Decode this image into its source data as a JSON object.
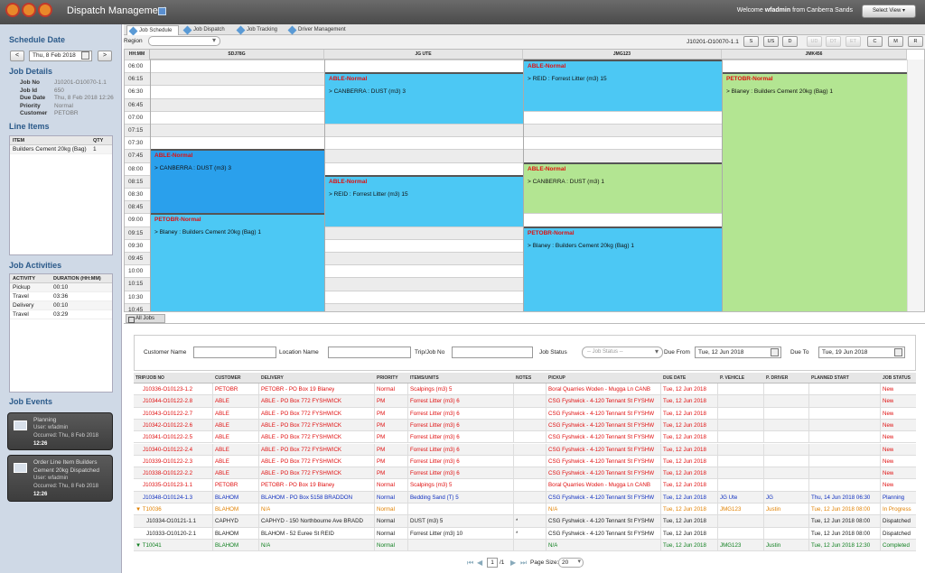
{
  "header": {
    "app_title": "Dispatch Management",
    "welcome_prefix": "Welcome",
    "user": "wfadmin",
    "welcome_suffix": "from Canberra Sands",
    "select_view": "Select View ▾"
  },
  "sidebar": {
    "schedule_date_title": "Schedule Date",
    "prev": "<",
    "next": ">",
    "date": "Thu, 8 Feb 2018",
    "job_details_title": "Job Details",
    "job_details": [
      {
        "label": "Job No",
        "value": "J10201-O10070-1.1"
      },
      {
        "label": "Job Id",
        "value": "650"
      },
      {
        "label": "Due Date",
        "value": "Thu, 8 Feb 2018 12:26"
      },
      {
        "label": "Priority",
        "value": "Normal"
      },
      {
        "label": "Customer",
        "value": "PETOBR"
      }
    ],
    "line_items_title": "Line Items",
    "line_items_headers": {
      "item": "ITEM",
      "qty": "QTY"
    },
    "line_items": [
      {
        "item": "Builders Cement 20kg (Bag)",
        "qty": "1"
      }
    ],
    "activities_title": "Job Activities",
    "activities_headers": {
      "activity": "ACTIVITY",
      "duration": "DURATION (HH:MM)"
    },
    "activities": [
      {
        "activity": "Pickup",
        "duration": "00:10"
      },
      {
        "activity": "Travel",
        "duration": "03:36"
      },
      {
        "activity": "Delivery",
        "duration": "00:10"
      },
      {
        "activity": "Travel",
        "duration": "03:29"
      }
    ],
    "events_title": "Job Events",
    "events": [
      {
        "title": "Planning",
        "user": "User: wfadmin",
        "occurred": "Occurred: Thu, 8 Feb 2018",
        "time": "12:26"
      },
      {
        "title": "Order Line Item Builders",
        "title2": "Cement 20kg Dispatched",
        "user": "User: wfadmin",
        "occurred": "Occurred: Thu, 8 Feb 2018",
        "time": "12:26"
      }
    ]
  },
  "tabs": [
    "Job Schedule",
    "Job Dispatch",
    "Job Tracking",
    "Driver Management"
  ],
  "schedule": {
    "region_label": "Region",
    "job_ref": "J10201-O10070-1.1",
    "view_buttons": [
      "S",
      "US",
      "D",
      "UD",
      "DT",
      "ET",
      "C",
      "M",
      "R"
    ],
    "disabled_buttons": [
      "UD",
      "DT",
      "ET"
    ],
    "time_header": "HH:MM",
    "columns": [
      "SDJ78G",
      "JG UTE",
      "JMG123",
      "JMK456"
    ],
    "times": [
      "06:00",
      "06:15",
      "06:30",
      "06:45",
      "07:00",
      "07:15",
      "07:30",
      "07:45",
      "08:00",
      "08:15",
      "08:30",
      "08:45",
      "09:00",
      "09:15",
      "09:30",
      "09:45",
      "10:00",
      "10:15",
      "10:30",
      "10:45"
    ],
    "blocks": [
      {
        "title": "ABLE-Normal",
        "detail": "> CANBERRA : DUST (m3) 3",
        "color": "dblue"
      },
      {
        "title": "PETOBR-Normal",
        "detail": "> Blaney : Builders Cement 20kg (Bag) 1",
        "color": "blue"
      },
      {
        "title": "ABLE-Normal",
        "detail": "> CANBERRA : DUST (m3) 3",
        "color": "blue"
      },
      {
        "title": "ABLE-Normal",
        "detail": "> REID : Forrest Litter (m3) 15",
        "color": "blue"
      },
      {
        "title": "ABLE-Normal",
        "detail": "> REID : Forrest Litter (m3) 15",
        "color": "blue"
      },
      {
        "title": "ABLE-Normal",
        "detail": "> CANBERRA : DUST (m3) 1",
        "color": "green"
      },
      {
        "title": "PETOBR-Normal",
        "detail": "> Blaney : Builders Cement 20kg (Bag) 1",
        "color": "blue"
      },
      {
        "title": "PETOBR-Normal",
        "detail": "> Blaney : Builders Cement 20kg (Bag) 1",
        "color": "green"
      }
    ]
  },
  "all_jobs": {
    "tab": "All Jobs",
    "filters": {
      "customer_name": "Customer Name",
      "location_name": "Location Name",
      "trip_job_no": "Trip/Job No",
      "job_status": "Job Status",
      "job_status_placeholder": "-- Job Status --",
      "due_from": "Due From",
      "due_from_value": "Tue, 12 Jun 2018",
      "due_to": "Due To",
      "due_to_value": "Tue, 19 Jun 2018"
    },
    "headers": [
      "TRIP/JOB NO",
      "CUSTOMER",
      "DELIVERY",
      "PRIORITY",
      "ITEMS/UNITS",
      "NOTES",
      "PICKUP",
      "DUE DATE",
      "P. VEHICLE",
      "P. DRIVER",
      "PLANNED START",
      "JOB STATUS"
    ],
    "rows": [
      {
        "c": [
          "J10336-O10123-1.2",
          "PETOBR",
          "PETOBR - PO Box 19 Blaney",
          "Normal",
          "Scalpings (m3) 5",
          "",
          "Boral Quarries Woden - Mugga Ln CANB",
          "Tue, 12 Jun 2018",
          "",
          "",
          "",
          "New"
        ],
        "color": "red"
      },
      {
        "c": [
          "J10344-O10122-2.8",
          "ABLE",
          "ABLE - PO Box 772 FYSHWICK",
          "PM",
          "Forrest Litter (m3) 6",
          "",
          "CSG Fyshwick - 4-120 Tennant St FYSHW",
          "Tue, 12 Jun 2018",
          "",
          "",
          "",
          "New"
        ],
        "color": "red"
      },
      {
        "c": [
          "J10343-O10122-2.7",
          "ABLE",
          "ABLE - PO Box 772 FYSHWICK",
          "PM",
          "Forrest Litter (m3) 6",
          "",
          "CSG Fyshwick - 4-120 Tennant St FYSHW",
          "Tue, 12 Jun 2018",
          "",
          "",
          "",
          "New"
        ],
        "color": "red"
      },
      {
        "c": [
          "J10342-O10122-2.6",
          "ABLE",
          "ABLE - PO Box 772 FYSHWICK",
          "PM",
          "Forrest Litter (m3) 6",
          "",
          "CSG Fyshwick - 4-120 Tennant St FYSHW",
          "Tue, 12 Jun 2018",
          "",
          "",
          "",
          "New"
        ],
        "color": "red"
      },
      {
        "c": [
          "J10341-O10122-2.5",
          "ABLE",
          "ABLE - PO Box 772 FYSHWICK",
          "PM",
          "Forrest Litter (m3) 6",
          "",
          "CSG Fyshwick - 4-120 Tennant St FYSHW",
          "Tue, 12 Jun 2018",
          "",
          "",
          "",
          "New"
        ],
        "color": "red"
      },
      {
        "c": [
          "J10340-O10122-2.4",
          "ABLE",
          "ABLE - PO Box 772 FYSHWICK",
          "PM",
          "Forrest Litter (m3) 6",
          "",
          "CSG Fyshwick - 4-120 Tennant St FYSHW",
          "Tue, 12 Jun 2018",
          "",
          "",
          "",
          "New"
        ],
        "color": "red"
      },
      {
        "c": [
          "J10339-O10122-2.3",
          "ABLE",
          "ABLE - PO Box 772 FYSHWICK",
          "PM",
          "Forrest Litter (m3) 6",
          "",
          "CSG Fyshwick - 4-120 Tennant St FYSHW",
          "Tue, 12 Jun 2018",
          "",
          "",
          "",
          "New"
        ],
        "color": "red"
      },
      {
        "c": [
          "J10338-O10122-2.2",
          "ABLE",
          "ABLE - PO Box 772 FYSHWICK",
          "PM",
          "Forrest Litter (m3) 6",
          "",
          "CSG Fyshwick - 4-120 Tennant St FYSHW",
          "Tue, 12 Jun 2018",
          "",
          "",
          "",
          "New"
        ],
        "color": "red"
      },
      {
        "c": [
          "J10335-O10123-1.1",
          "PETOBR",
          "PETOBR - PO Box 19 Blaney",
          "Normal",
          "Scalpings (m3) 5",
          "",
          "Boral Quarries Woden - Mugga Ln CANB",
          "Tue, 12 Jun 2018",
          "",
          "",
          "",
          "New"
        ],
        "color": "red"
      },
      {
        "c": [
          "J10348-O10124-1.3",
          "BLAHOM",
          "BLAHOM - PO Box 5158 BRADDON",
          "Normal",
          "Bedding Sand (T) 5",
          "",
          "CSG Fyshwick - 4-120 Tennant St FYSHW",
          "Tue, 12 Jun 2018",
          "JG Ute",
          "JG",
          "Thu, 14 Jun 2018 06:30",
          "Planning"
        ],
        "color": "blu"
      },
      {
        "c": [
          "▼ T10036",
          "BLAHOM",
          "N/A",
          "Normal",
          "",
          "",
          "N/A",
          "Tue, 12 Jun 2018",
          "JMG123",
          "Justin",
          "Tue, 12 Jun 2018 08:00",
          "In Progress"
        ],
        "color": "orn"
      },
      {
        "c": [
          "J10334-O10121-1.1",
          "CAPHYD",
          "CAPHYD - 150 Northbourne Ave BRADD",
          "Normal",
          "DUST (m3) 5",
          "*",
          "CSG Fyshwick - 4-120 Tennant St FYSHW",
          "Tue, 12 Jun 2018",
          "",
          "",
          "Tue, 12 Jun 2018 08:00",
          "Dispatched"
        ],
        "color": "blk",
        "indent": true
      },
      {
        "c": [
          "J10333-O10120-2.1",
          "BLAHOM",
          "BLAHOM - 52 Euree St REID",
          "Normal",
          "Forrest Litter (m3) 10",
          "*",
          "CSG Fyshwick - 4-120 Tennant St FYSHW",
          "Tue, 12 Jun 2018",
          "",
          "",
          "Tue, 12 Jun 2018 08:00",
          "Dispatched"
        ],
        "color": "blk",
        "indent": true
      },
      {
        "c": [
          "▼ T10041",
          "BLAHOM",
          "N/A",
          "Normal",
          "",
          "",
          "N/A",
          "Tue, 12 Jun 2018",
          "JMG123",
          "Justin",
          "Tue, 12 Jun 2018 12:30",
          "Completed"
        ],
        "color": "grn"
      }
    ],
    "pager": {
      "page": "1",
      "of": "/1",
      "page_size_label": "Page Size:",
      "page_size": "20"
    }
  }
}
